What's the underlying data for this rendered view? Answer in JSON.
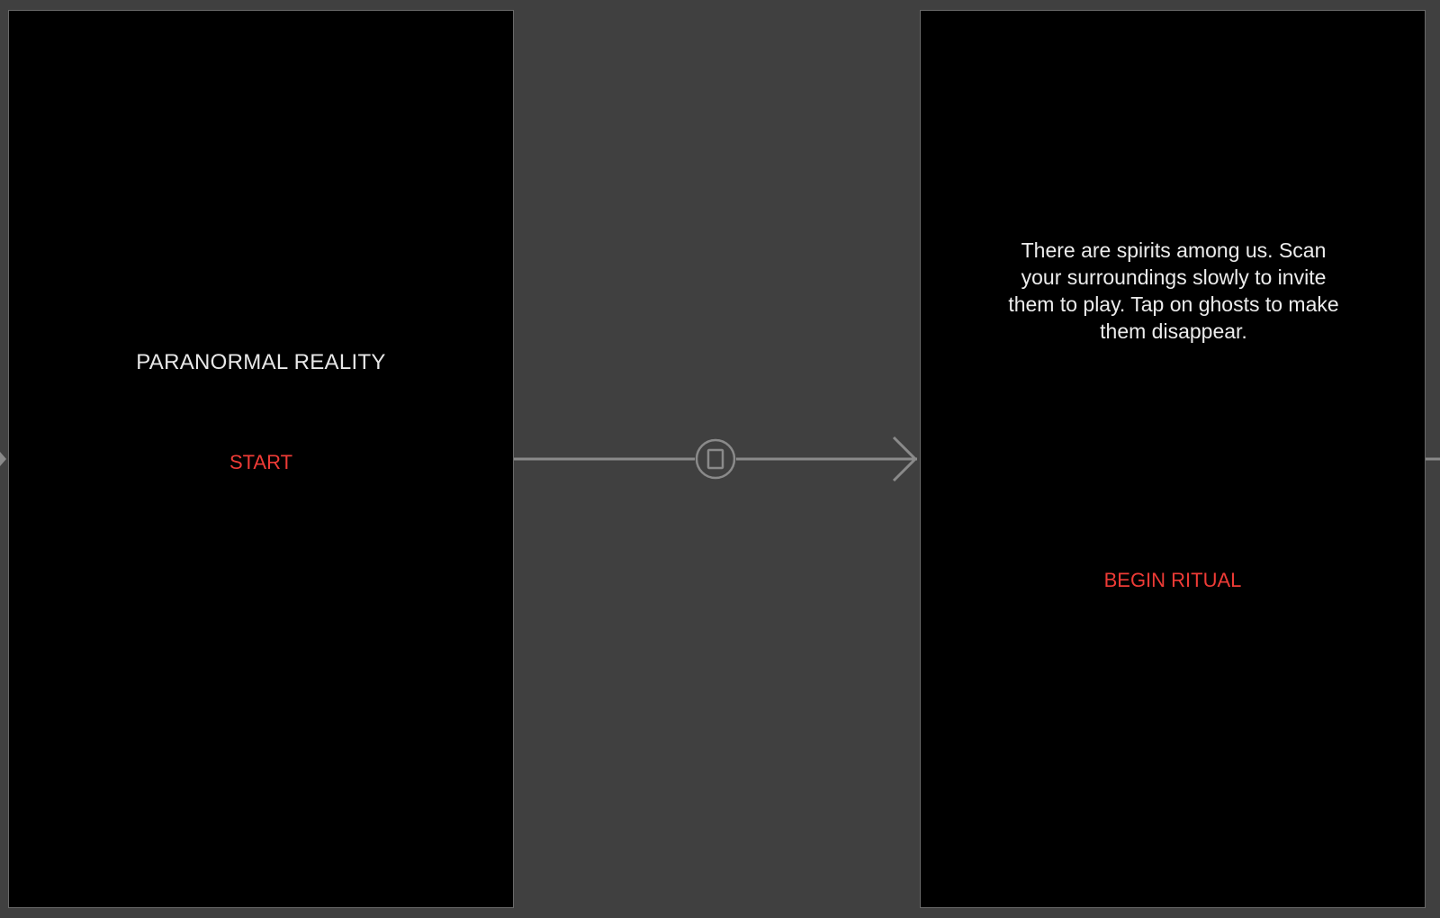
{
  "scenes": {
    "title_scene": {
      "title": "PARANORMAL REALITY",
      "start_label": "START"
    },
    "instructions_scene": {
      "text": "There are spirits among us. Scan your surroundings slowly to invite them to play. Tap on ghosts to make them disappear.",
      "begin_label": "BEGIN RITUAL"
    }
  },
  "segue": {
    "icon": "modal-segue-icon",
    "arrow_icon": "chevron-right-icon"
  },
  "colors": {
    "canvas_bg": "#404040",
    "scene_bg": "#000000",
    "accent_red": "#ee3b36",
    "text_light": "#e8e8e8",
    "connector_gray": "#8a8a8a"
  }
}
